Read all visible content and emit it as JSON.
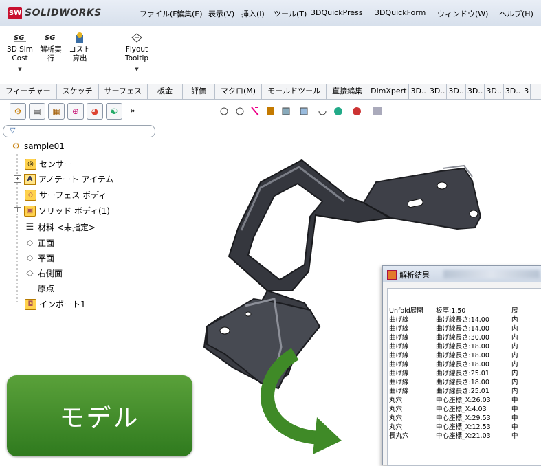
{
  "app": {
    "logo_text": "SOLIDWORKS",
    "logo_mark": "SW"
  },
  "menu": [
    "ファイル(F)",
    "編集(E)",
    "表示(V)",
    "挿入(I)",
    "ツール(T)",
    "3DQuickPress",
    "3DQuickForm",
    "ウィンドウ(W)",
    "ヘルプ(H)"
  ],
  "commands": [
    {
      "label": "3D Sim Cost",
      "icon": "sim-cost-icon"
    },
    {
      "label": "解析実行",
      "icon": "analysis-run-icon"
    },
    {
      "label": "コスト算出",
      "icon": "cost-calc-icon"
    },
    {
      "label": "Flyout Tooltip",
      "icon": "flyout-icon"
    }
  ],
  "tabs": [
    "フィーチャー",
    "スケッチ",
    "サーフェス",
    "板金",
    "評価",
    "マクロ(M)",
    "モールドツール",
    "直接編集",
    "DimXpert",
    "3D..",
    "3D..",
    "3D..",
    "3D..",
    "3D..",
    "3D..",
    "3"
  ],
  "tree": {
    "root": "sample01",
    "items": [
      {
        "label": "センサー",
        "icon": "sensor-icon",
        "expand": false
      },
      {
        "label": "アノテート アイテム",
        "icon": "annotation-icon",
        "expand": true
      },
      {
        "label": "サーフェス ボディ",
        "icon": "surface-body-icon",
        "expand": false
      },
      {
        "label": "ソリッド ボディ(1)",
        "icon": "solid-body-icon",
        "expand": true
      },
      {
        "label": "材料 <未指定>",
        "icon": "material-icon",
        "expand": false
      },
      {
        "label": "正面",
        "icon": "plane-icon",
        "expand": false
      },
      {
        "label": "平面",
        "icon": "plane-icon",
        "expand": false
      },
      {
        "label": "右側面",
        "icon": "plane-icon",
        "expand": false
      },
      {
        "label": "原点",
        "icon": "origin-icon",
        "expand": false
      },
      {
        "label": "インポート1",
        "icon": "import-icon",
        "expand": false
      }
    ]
  },
  "model_button": "モデル",
  "results": {
    "title": "解析結果",
    "rows": [
      [
        "Unfold展開",
        "板厚:1.50",
        "展"
      ],
      [
        "曲げ線",
        "曲げ線長さ:14.00",
        "内"
      ],
      [
        "曲げ線",
        "曲げ線長さ:14.00",
        "内"
      ],
      [
        "曲げ線",
        "曲げ線長さ:30.00",
        "内"
      ],
      [
        "曲げ線",
        "曲げ線長さ:18.00",
        "内"
      ],
      [
        "曲げ線",
        "曲げ線長さ:18.00",
        "内"
      ],
      [
        "曲げ線",
        "曲げ線長さ:18.00",
        "内"
      ],
      [
        "曲げ線",
        "曲げ線長さ:25.01",
        "内"
      ],
      [
        "曲げ線",
        "曲げ線長さ:18.00",
        "内"
      ],
      [
        "曲げ線",
        "曲げ線長さ:25.01",
        "内"
      ],
      [
        "丸穴",
        "中心座標_X:26.03",
        "中"
      ],
      [
        "丸穴",
        "中心座標_X:4.03",
        "中"
      ],
      [
        "丸穴",
        "中心座標_X:29.53",
        "中"
      ],
      [
        "丸穴",
        "中心座標_X:12.53",
        "中"
      ],
      [
        "長丸穴",
        "中心座標_X:21.03",
        "中"
      ]
    ]
  },
  "colors": {
    "accent_green": "#3f8a27",
    "part_dark": "#3a3c44",
    "menubar": "#dde5f0"
  }
}
